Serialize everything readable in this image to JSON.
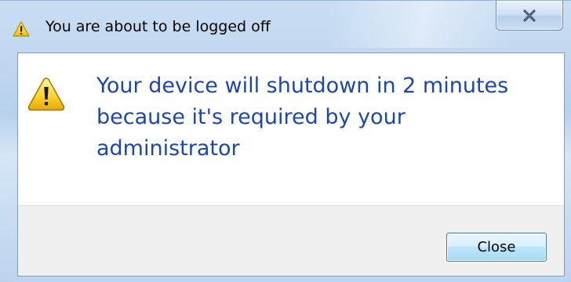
{
  "window": {
    "title": "You are about to be logged off",
    "title_icon": "warning-icon",
    "close_icon": "close-icon"
  },
  "dialog": {
    "icon": "warning-icon",
    "message_line_1": "Your device will shutdown in 2 minutes",
    "message_line_2": "because it's required by your",
    "message_line_3": "administrator",
    "message_color": "#1c46b0"
  },
  "buttons": {
    "close_label": "Close"
  }
}
